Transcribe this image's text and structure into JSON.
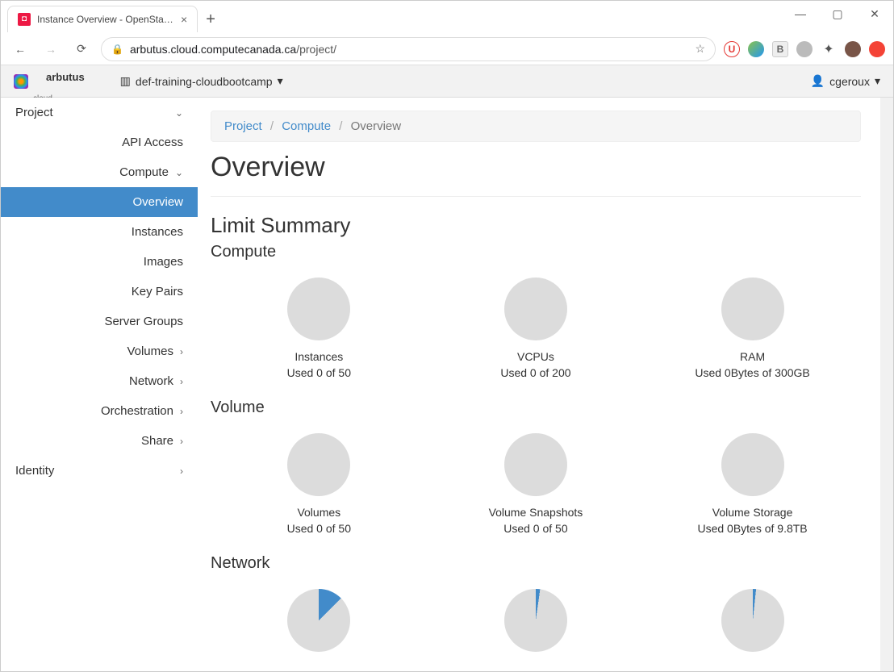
{
  "browser": {
    "tab_title": "Instance Overview - OpenStack D",
    "url_prefix": "arbutus.cloud.computecanada.ca",
    "url_path": "/project/"
  },
  "appbar": {
    "logo_main": "arbutus",
    "logo_sub": "cloud",
    "project_selector": "def-training-cloudbootcamp",
    "user": "cgeroux"
  },
  "sidebar": {
    "project": "Project",
    "api_access": "API Access",
    "compute": "Compute",
    "compute_items": {
      "overview": "Overview",
      "instances": "Instances",
      "images": "Images",
      "key_pairs": "Key Pairs",
      "server_groups": "Server Groups"
    },
    "volumes": "Volumes",
    "network": "Network",
    "orchestration": "Orchestration",
    "share": "Share",
    "identity": "Identity"
  },
  "breadcrumb": {
    "project": "Project",
    "compute": "Compute",
    "overview": "Overview"
  },
  "page": {
    "title": "Overview",
    "limit_summary": "Limit Summary",
    "compute_section": "Compute",
    "volume_section": "Volume",
    "network_section": "Network"
  },
  "quotas": {
    "compute": [
      {
        "label": "Instances",
        "usage": "Used 0 of 50"
      },
      {
        "label": "VCPUs",
        "usage": "Used 0 of 200"
      },
      {
        "label": "RAM",
        "usage": "Used 0Bytes of 300GB"
      }
    ],
    "volume": [
      {
        "label": "Volumes",
        "usage": "Used 0 of 50"
      },
      {
        "label": "Volume Snapshots",
        "usage": "Used 0 of 50"
      },
      {
        "label": "Volume Storage",
        "usage": "Used 0Bytes of 9.8TB"
      }
    ]
  }
}
